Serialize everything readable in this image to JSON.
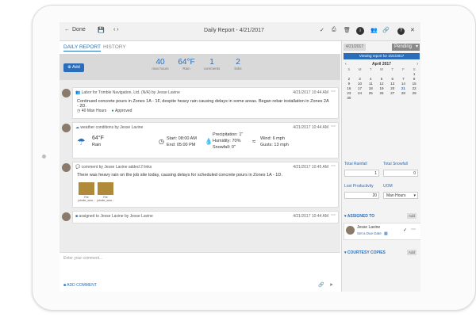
{
  "topbar": {
    "back_label": "Done",
    "title": "Daily Report - 4/21/2017",
    "left_icons": [
      "back-arrow-icon",
      "save-icon",
      "prev-next-icon"
    ],
    "right_icons": [
      "check-icon",
      "print-icon",
      "delete-icon",
      "info-icon",
      "people-icon",
      "link-icon",
      "help-icon",
      "close-icon"
    ]
  },
  "tabs": [
    {
      "label": "DAILY REPORT",
      "active": true
    },
    {
      "label": "HISTORY",
      "active": false
    }
  ],
  "stats": {
    "add_label": "Add",
    "items": [
      {
        "value": "40",
        "label": "man hours"
      },
      {
        "value": "64°F",
        "label": "Rain"
      },
      {
        "value": "1",
        "label": "comments"
      },
      {
        "value": "2",
        "label": "links"
      }
    ]
  },
  "feed": {
    "labor": {
      "header": "Labor for Trimble Navigation, Ltd. (N/A) by Jesse Lavine",
      "time": "4/21/2017 10:44 AM",
      "text": "Continued concrete pours in Zones 1A - 1F, despite heavy rain causing delays in some areas. Began rebar installation in Zones 2A - 2D.",
      "hours": "40 Man Hours",
      "status": "Approved"
    },
    "weather": {
      "header": "weather conditions by Jesse Lavine",
      "time": "4/21/2017 10:44 AM",
      "temp": "64°F",
      "condition": "Rain",
      "start": "Start: 08:00 AM",
      "end": "End: 05:00 PM",
      "precip": "Precipitation: 1\"",
      "humidity": "Humidity: 70%",
      "snowfall": "Snowfall: 0\"",
      "wind": "Wind: 6 mph",
      "gusts": "Gusts: 13 mph"
    },
    "comment": {
      "header": "comment by Jesse Lavine added 2 links",
      "time": "4/21/2017 10:45 AM",
      "text": "There was heavy rain on the job site today, causing delays for scheduled concrete pours in Zones 1A - 1D.",
      "thumbs": [
        {
          "label": "File jobsite_wea..."
        },
        {
          "label": "File jobsite_wea..."
        }
      ]
    },
    "assigned": {
      "header": "assigned to Jesse Lavine by Jesse Lavine",
      "time": "4/21/2017 10:44 AM"
    }
  },
  "comment_box": {
    "placeholder": "Enter your comment...",
    "add_label": "ADD COMMENT"
  },
  "right": {
    "date": "4/21/2017",
    "status": "Pending",
    "viewing": "Viewing report for 4/21/2017",
    "calendar": {
      "month": "April 2017",
      "days_of_week": [
        "S",
        "M",
        "T",
        "W",
        "T",
        "F",
        "S"
      ],
      "weeks": [
        [
          "",
          "",
          "",
          "",
          "",
          "",
          "1"
        ],
        [
          "2",
          "3",
          "4",
          "5",
          "6",
          "7",
          "8"
        ],
        [
          "9",
          "10",
          "11",
          "12",
          "13",
          "14",
          "15"
        ],
        [
          "16",
          "17",
          "18",
          "19",
          "20",
          "21",
          "22"
        ],
        [
          "23",
          "24",
          "25",
          "26",
          "27",
          "28",
          "29"
        ],
        [
          "30",
          "",
          "",
          "",
          "",
          "",
          ""
        ]
      ],
      "selected": "21"
    },
    "total_rainfall_label": "Total Rainfall",
    "total_rainfall_value": "1",
    "total_snowfall_label": "Total Snowfall",
    "total_snowfall_value": "0",
    "lost_productivity_label": "Lost Productivity",
    "lost_productivity_value": "20",
    "uom_label": "UOM",
    "uom_value": "Man Hours",
    "assigned_to_label": "ASSIGNED TO",
    "assignee_name": "Jesse Lavine",
    "set_due_date": "Set a Due Date",
    "courtesy_copies_label": "COURTESY COPIES",
    "add_label": "Add"
  },
  "colors": {
    "accent": "#2a6ebb",
    "approved": "#2e8b3e"
  }
}
